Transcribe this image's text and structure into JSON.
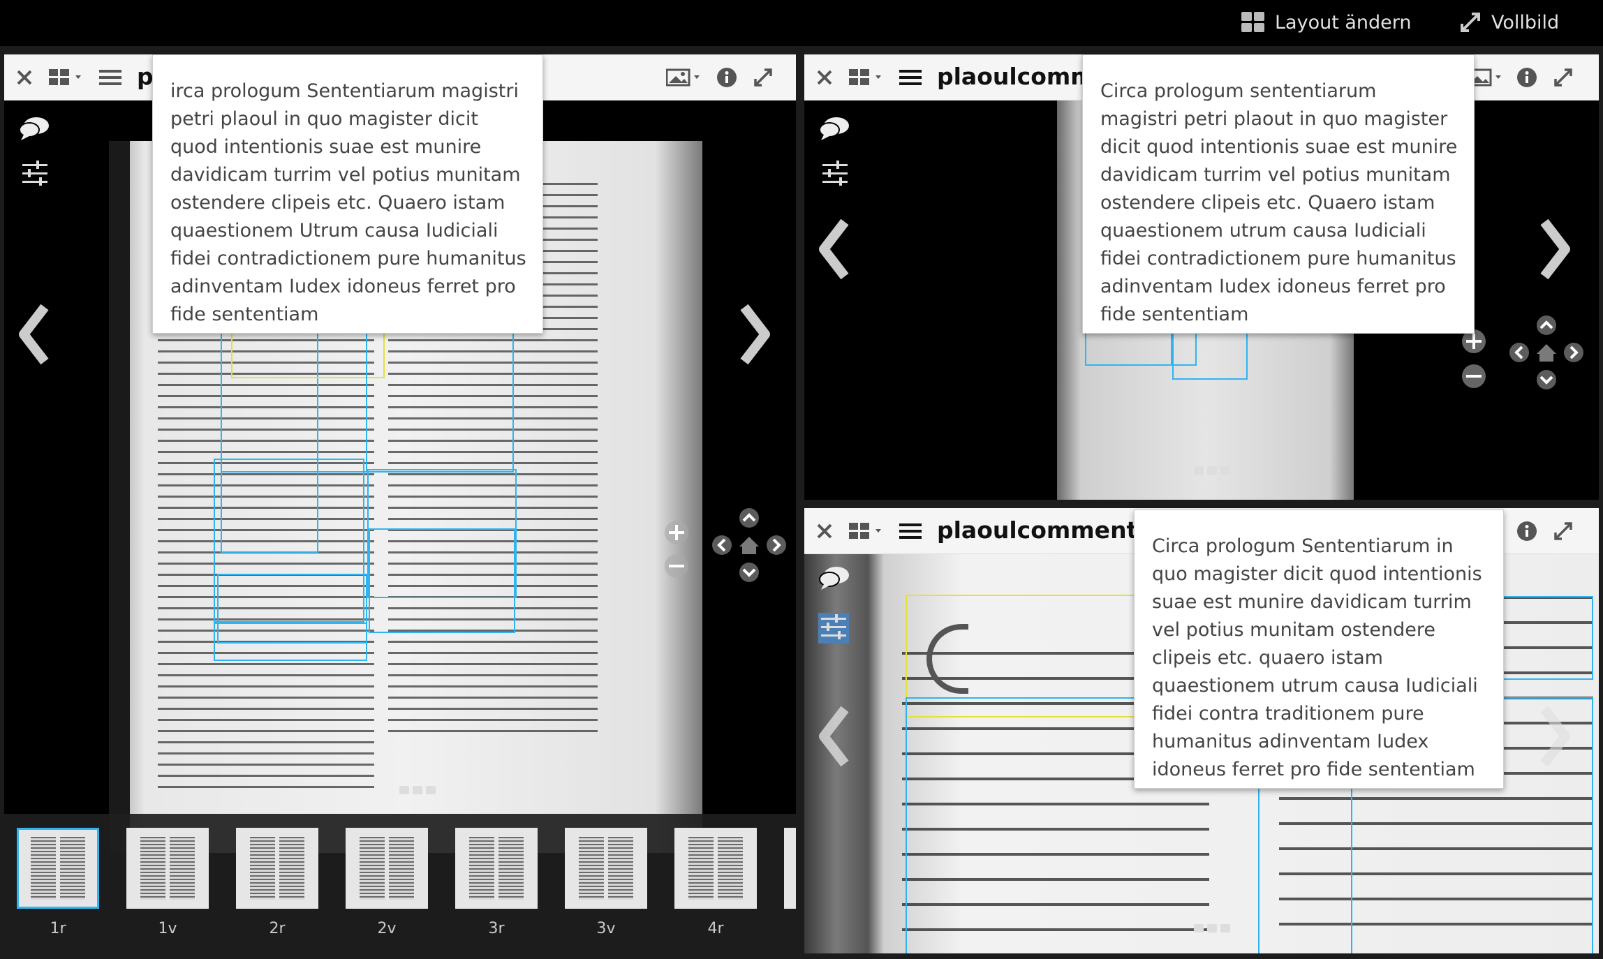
{
  "topbar": {
    "layout_label": "Layout ändern",
    "fullscreen_label": "Vollbild"
  },
  "panels": [
    {
      "title": "p",
      "tooltip": "irca prologum Sententiarum magistri petri plaoul in quo magister dicit quod intentionis suae est munire davidicam turrim vel potius munitam ostendere clipeis etc. Quaero istam quaestionem Utrum causa Iudiciali fidei contradictionem pure humanitus adinventam Iudex idoneus ferret pro fide sententiam",
      "thumbnails": [
        "1r",
        "1v",
        "2r",
        "2v",
        "3r",
        "3v",
        "4r"
      ]
    },
    {
      "title": "plaoulcomme",
      "tooltip": "Circa prologum sententiarum magistri petri plaout in quo magister dicit quod intentionis suae est munire davidicam turrim vel potius munitam ostendere clipeis etc. Quaero istam quaestionem utrum causa Iudiciali fidei contradictionem pure humanitus adinventam Iudex idoneus ferret pro fide sententiam"
    },
    {
      "title": "plaoulcommentar",
      "tooltip": "Circa prologum Sententiarum in quo magister dicit quod intentionis suae est munire davidicam turrim vel potius munitam ostendere clipeis etc. quaero istam quaestionem utrum causa Iudiciali fidei contra traditionem pure humanitus adinventam Iudex idoneus ferret pro fide sententiam"
    }
  ]
}
